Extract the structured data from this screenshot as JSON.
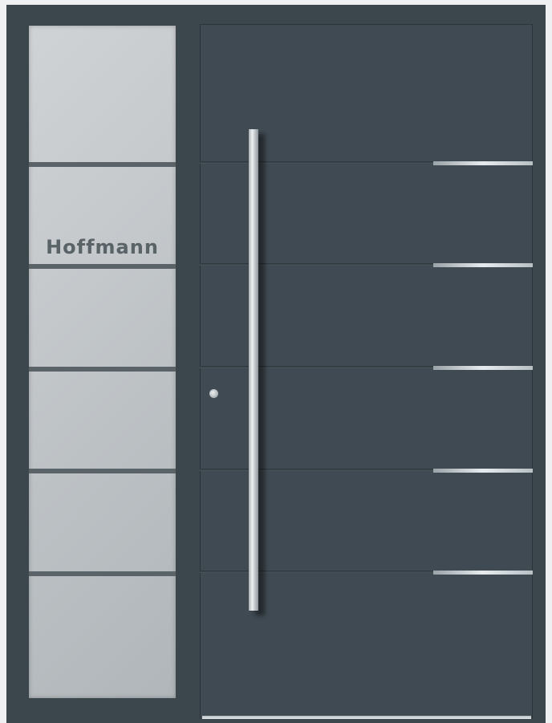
{
  "sidelight": {
    "nameplate": "Hoffmann"
  },
  "colors": {
    "frame": "#3c464d",
    "door_leaf": "#3f4a52",
    "glass": "#c5c9cc",
    "stainless": "#e7ebed"
  }
}
